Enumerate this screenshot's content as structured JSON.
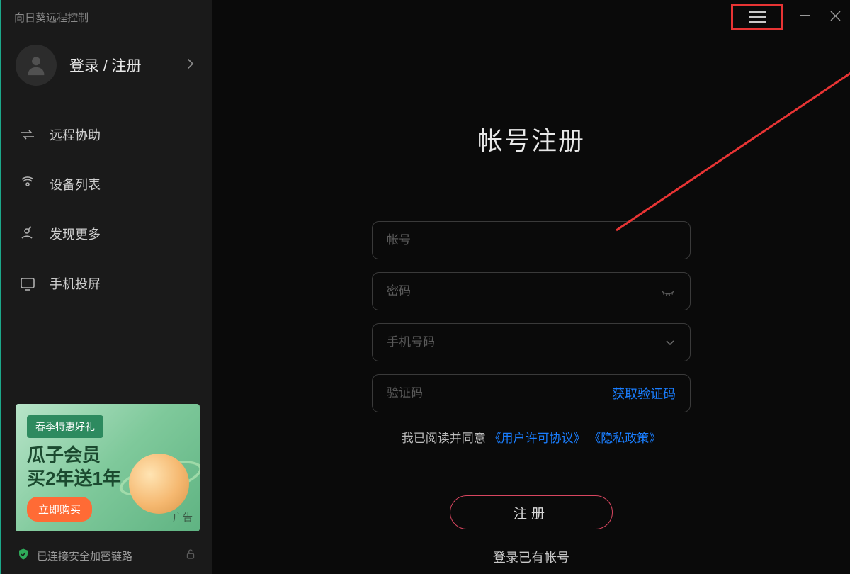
{
  "app_title": "向日葵远程控制",
  "profile": {
    "login_text": "登录 / 注册"
  },
  "nav": {
    "items": [
      {
        "label": "远程协助"
      },
      {
        "label": "设备列表"
      },
      {
        "label": "发现更多"
      },
      {
        "label": "手机投屏"
      }
    ]
  },
  "promo": {
    "badge": "春季特惠好礼",
    "line1": "瓜子会员",
    "line2": "买2年送1年",
    "buy": "立即购买",
    "adtag": "广告"
  },
  "status": {
    "text": "已连接安全加密链路"
  },
  "form": {
    "title": "帐号注册",
    "ph_account": "帐号",
    "ph_password": "密码",
    "ph_phone": "手机号码",
    "ph_code": "验证码",
    "get_code": "获取验证码",
    "agree_prefix": "我已阅读并同意",
    "license": "《用户许可协议》",
    "privacy": "《隐私政策》",
    "submit": "注册",
    "alt_login": "登录已有帐号"
  },
  "colors": {
    "highlight": "#e83434",
    "link": "#1a7eff",
    "accent": "#d84660"
  }
}
